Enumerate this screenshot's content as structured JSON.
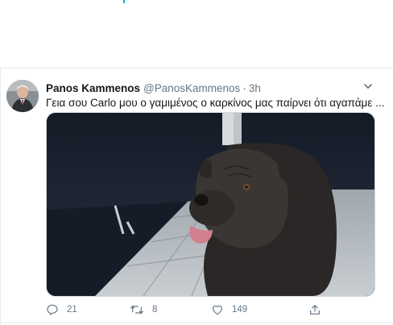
{
  "tweet": {
    "author_name": "Panos Kammenos",
    "author_handle": "@PanosKammenos",
    "separator": "·",
    "time": "3h",
    "text": "Γεια σου Carlo μου ο γαμιμένος ο καρκίνος μας παίρνει ότι αγαπάμε ...",
    "media_icon": "photo-dog"
  },
  "actions": {
    "reply_count": "21",
    "retweet_count": "8",
    "like_count": "149"
  },
  "colors": {
    "text_primary": "#14171a",
    "text_secondary": "#657786",
    "accent": "#1da1f2",
    "border": "#e6ecf0"
  }
}
